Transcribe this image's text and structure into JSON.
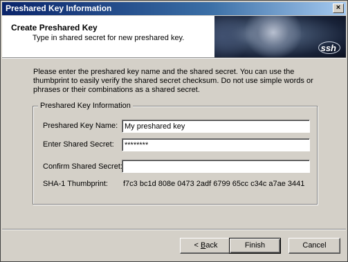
{
  "window": {
    "title": "Preshared Key Information",
    "close_glyph": "×"
  },
  "header": {
    "title": "Create Preshared Key",
    "subtitle": "Type in shared secret for new preshared key.",
    "logo_text": "ssh"
  },
  "intro_text": "Please enter the preshared key name and the shared secret. You can use the thumbprint to easily verify the shared secret checksum. Do not use simple words or phrases or their combinations as a shared secret.",
  "group": {
    "legend": "Preshared Key Information",
    "name_label": "Preshared Key Name:",
    "name_value": "My preshared key",
    "secret_label": "Enter Shared Secret:",
    "secret_value": "********",
    "confirm_label": "Confirm Shared Secret:",
    "confirm_value": "",
    "thumb_label": "SHA-1 Thumbprint:",
    "thumb_value": "f7c3 bc1d 808e 0473 2adf  6799 65cc c34c a7ae 3441"
  },
  "buttons": {
    "back_prefix": "< ",
    "back_mnemonic": "B",
    "back_rest": "ack",
    "finish": "Finish",
    "cancel": "Cancel"
  }
}
